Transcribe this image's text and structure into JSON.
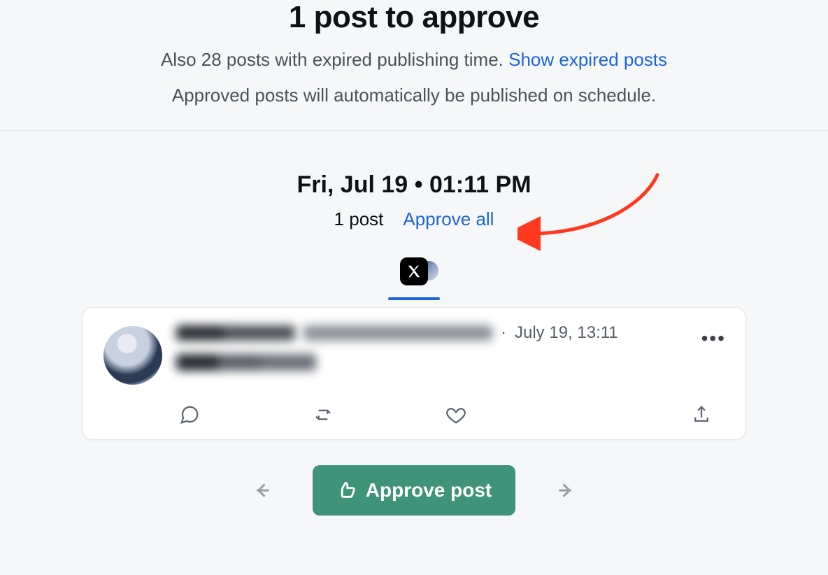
{
  "header": {
    "title": "1 post to approve",
    "expired_prefix": "Also 28 posts with expired publishing time. ",
    "expired_link": "Show expired posts",
    "info": "Approved posts will automatically be published on schedule."
  },
  "schedule": {
    "datetime": "Fri, Jul 19 • 01:11 PM",
    "count": "1 post",
    "approve_all": "Approve all"
  },
  "post": {
    "timestamp_sep": " · ",
    "timestamp": "July 19, 13:11",
    "more_glyph": "•••"
  },
  "buttons": {
    "approve": "Approve post"
  },
  "colors": {
    "link": "#1b64da",
    "approve_bg": "#3f9378",
    "arrow_annotation": "#ff3820"
  }
}
